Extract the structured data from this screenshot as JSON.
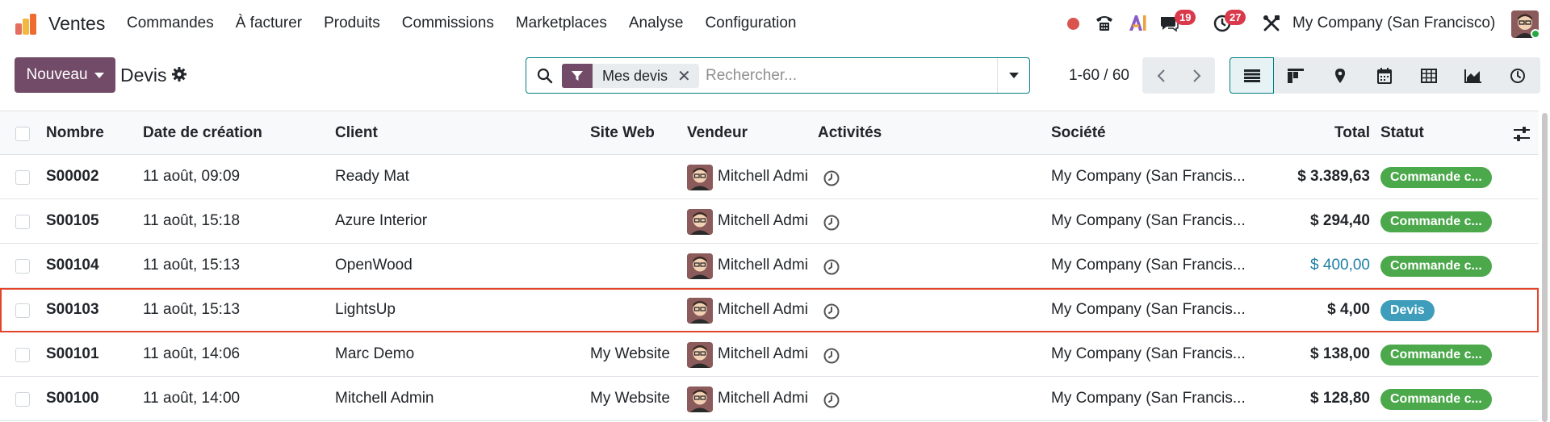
{
  "app": {
    "name": "Ventes"
  },
  "menu": [
    "Commandes",
    "À facturer",
    "Produits",
    "Commissions",
    "Marketplaces",
    "Analyse",
    "Configuration"
  ],
  "systray": {
    "messages_count": "19",
    "activities_count": "27",
    "company": "My Company (San Francisco)"
  },
  "control": {
    "new_label": "Nouveau",
    "title": "Devis",
    "facet_label": "Mes devis",
    "search_placeholder": "Rechercher...",
    "pager": "1-60 / 60"
  },
  "columns": [
    "Nombre",
    "Date de création",
    "Client",
    "Site Web",
    "Vendeur",
    "Activités",
    "Société",
    "Total",
    "Statut"
  ],
  "rows": [
    {
      "number": "S00002",
      "date": "11 août, 09:09",
      "client": "Ready Mat",
      "website": "",
      "salesperson": "Mitchell Admi",
      "company": "My Company (San Francis...",
      "total": "$ 3.389,63",
      "status": "Commande c...",
      "status_kind": "green"
    },
    {
      "number": "S00105",
      "date": "11 août, 15:18",
      "client": "Azure Interior",
      "website": "",
      "salesperson": "Mitchell Admi",
      "company": "My Company (San Francis...",
      "total": "$ 294,40",
      "status": "Commande c...",
      "status_kind": "green"
    },
    {
      "number": "S00104",
      "date": "11 août, 15:13",
      "client": "OpenWood",
      "website": "",
      "salesperson": "Mitchell Admi",
      "company": "My Company (San Francis...",
      "total": "$ 400,00",
      "status": "Commande c...",
      "status_kind": "green"
    },
    {
      "number": "S00103",
      "date": "11 août, 15:13",
      "client": "LightsUp",
      "website": "",
      "salesperson": "Mitchell Admi",
      "company": "My Company (San Francis...",
      "total": "$ 4,00",
      "status": "Devis",
      "status_kind": "blue"
    },
    {
      "number": "S00101",
      "date": "11 août, 14:06",
      "client": "Marc Demo",
      "website": "My Website",
      "salesperson": "Mitchell Admi",
      "company": "My Company (San Francis...",
      "total": "$ 138,00",
      "status": "Commande c...",
      "status_kind": "green"
    },
    {
      "number": "S00100",
      "date": "11 août, 14:00",
      "client": "Mitchell Admin",
      "website": "My Website",
      "salesperson": "Mitchell Admi",
      "company": "My Company (San Francis...",
      "total": "$ 128,80",
      "status": "Commande c...",
      "status_kind": "green"
    }
  ],
  "colors": {
    "primary": "#714b67",
    "accent": "#017e84",
    "highlight": "#e3452b",
    "status_green": "#4ba84b",
    "status_blue": "#3d9dbb",
    "badge": "#d9394a"
  }
}
